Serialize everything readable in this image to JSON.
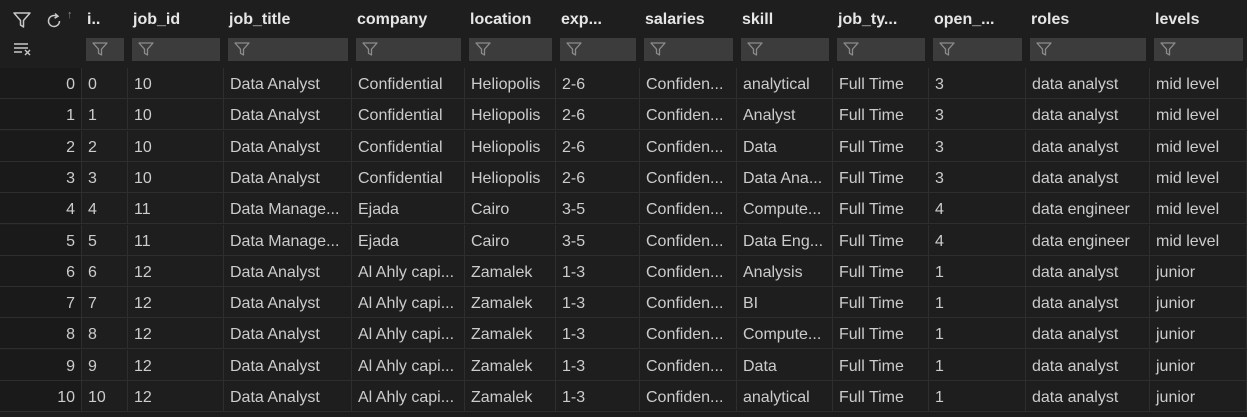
{
  "toolbar": {
    "filter_icon": "filter-icon",
    "refresh_icon": "refresh-icon",
    "sort_up_glyph": "↑",
    "clear_filters_icon": "clear-filters-icon"
  },
  "columns": [
    {
      "key": "i",
      "label": "i.."
    },
    {
      "key": "job_id",
      "label": "job_id"
    },
    {
      "key": "job_title",
      "label": "job_title"
    },
    {
      "key": "company",
      "label": "company"
    },
    {
      "key": "location",
      "label": "location"
    },
    {
      "key": "exp",
      "label": "exp..."
    },
    {
      "key": "salaries",
      "label": "salaries"
    },
    {
      "key": "skill",
      "label": "skill"
    },
    {
      "key": "job_type",
      "label": "job_ty..."
    },
    {
      "key": "open",
      "label": "open_..."
    },
    {
      "key": "roles",
      "label": "roles"
    },
    {
      "key": "levels",
      "label": "levels"
    }
  ],
  "rows": [
    {
      "idx": "0",
      "cells": [
        "0",
        "10",
        "Data Analyst",
        "Confidential",
        "Heliopolis",
        "2-6",
        "Confiden...",
        "analytical",
        "Full Time",
        "3",
        "data analyst",
        "mid level"
      ]
    },
    {
      "idx": "1",
      "cells": [
        "1",
        "10",
        "Data Analyst",
        "Confidential",
        "Heliopolis",
        "2-6",
        "Confiden...",
        "Analyst",
        "Full Time",
        "3",
        "data analyst",
        "mid level"
      ]
    },
    {
      "idx": "2",
      "cells": [
        "2",
        "10",
        "Data Analyst",
        "Confidential",
        "Heliopolis",
        "2-6",
        "Confiden...",
        "Data",
        "Full Time",
        "3",
        "data analyst",
        "mid level"
      ]
    },
    {
      "idx": "3",
      "cells": [
        "3",
        "10",
        "Data Analyst",
        "Confidential",
        "Heliopolis",
        "2-6",
        "Confiden...",
        "Data Ana...",
        "Full Time",
        "3",
        "data analyst",
        "mid level"
      ]
    },
    {
      "idx": "4",
      "cells": [
        "4",
        "11",
        "Data Manage...",
        "Ejada",
        "Cairo",
        "3-5",
        "Confiden...",
        "Compute...",
        "Full Time",
        "4",
        "data engineer",
        "mid level"
      ]
    },
    {
      "idx": "5",
      "cells": [
        "5",
        "11",
        "Data Manage...",
        "Ejada",
        "Cairo",
        "3-5",
        "Confiden...",
        "Data Eng...",
        "Full Time",
        "4",
        "data engineer",
        "mid level"
      ]
    },
    {
      "idx": "6",
      "cells": [
        "6",
        "12",
        "Data Analyst",
        "Al Ahly capi...",
        "Zamalek",
        "1-3",
        "Confiden...",
        "Analysis",
        "Full Time",
        "1",
        "data analyst",
        "junior"
      ]
    },
    {
      "idx": "7",
      "cells": [
        "7",
        "12",
        "Data Analyst",
        "Al Ahly capi...",
        "Zamalek",
        "1-3",
        "Confiden...",
        "BI",
        "Full Time",
        "1",
        "data analyst",
        "junior"
      ]
    },
    {
      "idx": "8",
      "cells": [
        "8",
        "12",
        "Data Analyst",
        "Al Ahly capi...",
        "Zamalek",
        "1-3",
        "Confiden...",
        "Compute...",
        "Full Time",
        "1",
        "data analyst",
        "junior"
      ]
    },
    {
      "idx": "9",
      "cells": [
        "9",
        "12",
        "Data Analyst",
        "Al Ahly capi...",
        "Zamalek",
        "1-3",
        "Confiden...",
        "Data",
        "Full Time",
        "1",
        "data analyst",
        "junior"
      ]
    },
    {
      "idx": "10",
      "cells": [
        "10",
        "12",
        "Data Analyst",
        "Al Ahly capi...",
        "Zamalek",
        "1-3",
        "Confiden...",
        "analytical",
        "Full Time",
        "1",
        "data analyst",
        "junior"
      ]
    }
  ]
}
